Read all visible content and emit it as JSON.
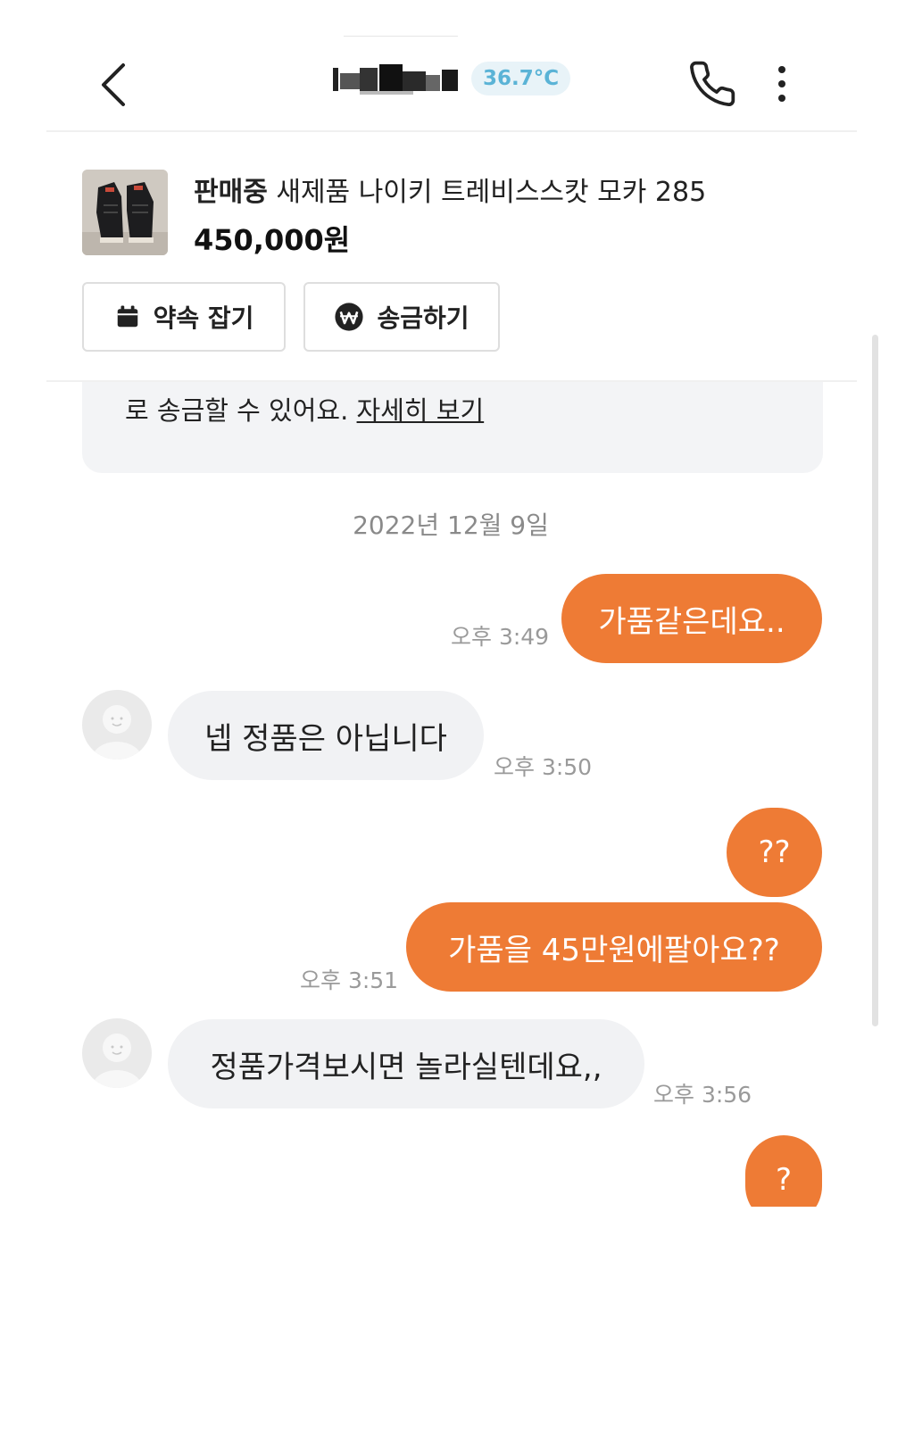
{
  "header": {
    "back_icon": "chevron-left-icon",
    "temperature": "36.7°C",
    "temperature_color": "#5ab3d6",
    "phone_icon": "phone-icon",
    "more_icon": "more-vertical-icon"
  },
  "product": {
    "status": "판매중",
    "title": "새제품 나이키 트레비스스캇 모카 285",
    "price": "450,000원"
  },
  "actions": {
    "schedule_label": "약속 잡기",
    "schedule_icon": "calendar-icon",
    "transfer_label": "송금하기",
    "transfer_icon": "won-icon"
  },
  "chat": {
    "notice_text": "로 송금할 수 있어요. ",
    "notice_link": "자세히 보기",
    "date_separator": "2022년 12월 9일",
    "accent_color": "#ee7b35",
    "messages": [
      {
        "sender": "me",
        "text": "가품같은데요..",
        "time": "오후 3:49"
      },
      {
        "sender": "other",
        "text": "넵 정품은 아닙니다",
        "time": "오후 3:50"
      },
      {
        "sender": "me",
        "text": "??",
        "time": ""
      },
      {
        "sender": "me",
        "text": "가품을 45만원에팔아요??",
        "time": "오후 3:51"
      },
      {
        "sender": "other",
        "text": "정품가격보시면 놀라실텐데요,,",
        "time": "오후 3:56"
      },
      {
        "sender": "me",
        "text": "?",
        "time": ""
      }
    ]
  }
}
